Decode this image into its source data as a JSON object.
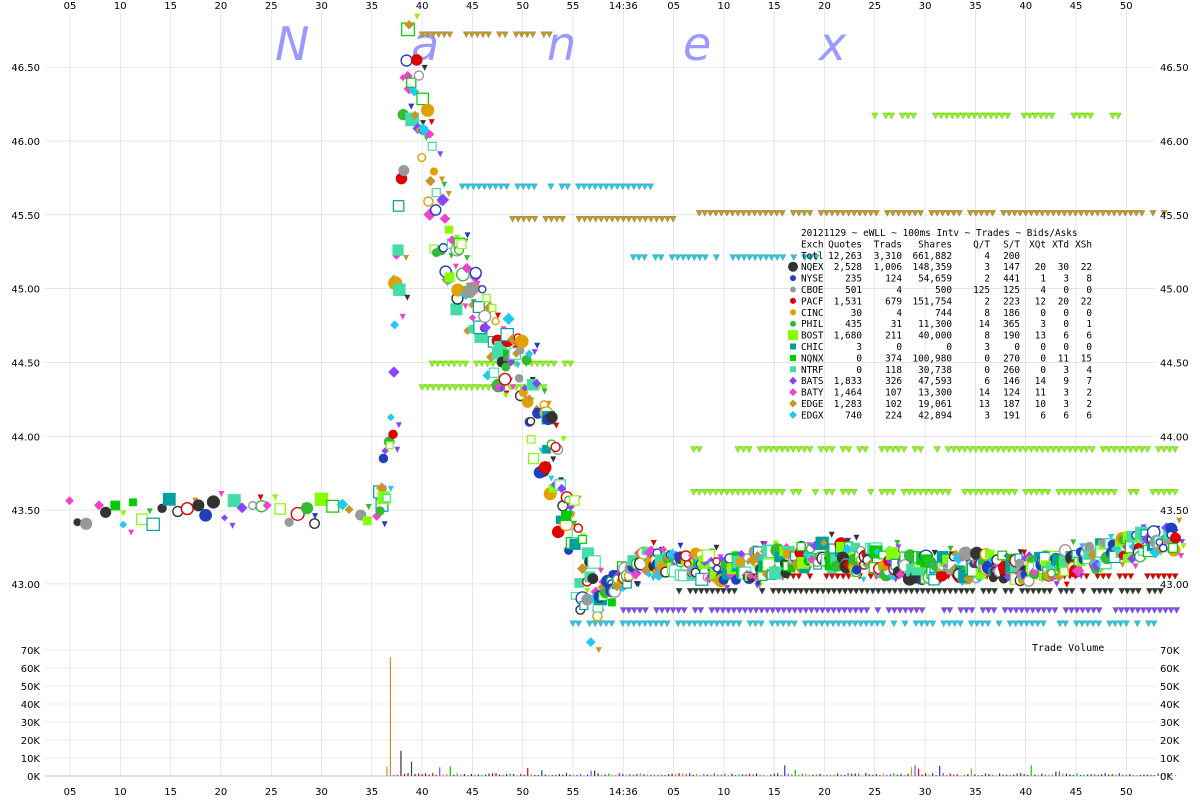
{
  "watermark": [
    "N",
    "a",
    "n",
    "e",
    "x"
  ],
  "chart_data": {
    "type": "scatter",
    "title": "20121129 ~ eWLL ~ 100ms Intv ~ Trades ~ Bids/Asks",
    "x_ticks": [
      "05",
      "10",
      "15",
      "20",
      "25",
      "30",
      "35",
      "40",
      "45",
      "50",
      "55",
      "14:36",
      "05",
      "10",
      "15",
      "20",
      "25",
      "30",
      "35",
      "40",
      "45",
      "50"
    ],
    "price_axis": {
      "ticks": [
        "46.50",
        "46.00",
        "45.50",
        "45.00",
        "44.50",
        "44.00",
        "43.50",
        "43.00"
      ],
      "values": [
        46.5,
        46.0,
        45.5,
        45.0,
        44.5,
        44.0,
        43.5,
        43.0
      ],
      "ylim": [
        42.62,
        46.82
      ]
    },
    "volume_axis": {
      "label": "Trade Volume",
      "ticks": [
        "70K",
        "60K",
        "50K",
        "40K",
        "30K",
        "20K",
        "10K",
        "0K"
      ],
      "values": [
        70000,
        60000,
        50000,
        40000,
        30000,
        20000,
        10000,
        0
      ],
      "ylim": [
        0,
        70000
      ]
    },
    "price_path": [
      [
        0,
        43.49
      ],
      [
        10,
        43.49
      ],
      [
        20,
        43.49
      ],
      [
        25,
        43.49
      ],
      [
        29,
        43.5
      ],
      [
        30.5,
        43.52
      ],
      [
        31.5,
        43.7
      ],
      [
        32,
        44.3
      ],
      [
        32.6,
        45.2
      ],
      [
        33.2,
        46.1
      ],
      [
        33.8,
        46.6
      ],
      [
        34.5,
        46.3
      ],
      [
        35.5,
        45.9
      ],
      [
        36.5,
        45.5
      ],
      [
        37.5,
        45.3
      ],
      [
        38.5,
        45.1
      ],
      [
        39.5,
        44.9
      ],
      [
        40.5,
        44.8
      ],
      [
        41.5,
        44.7
      ],
      [
        42.5,
        44.6
      ],
      [
        43.5,
        44.5
      ],
      [
        44.5,
        44.4
      ],
      [
        45.5,
        44.3
      ],
      [
        46.5,
        44.1
      ],
      [
        47.5,
        43.9
      ],
      [
        48.5,
        43.7
      ],
      [
        49.5,
        43.4
      ],
      [
        50.5,
        43.1
      ],
      [
        51.5,
        42.9
      ],
      [
        52.5,
        42.85
      ],
      [
        53.5,
        42.95
      ],
      [
        55,
        43.05
      ],
      [
        57,
        43.15
      ],
      [
        60,
        43.15
      ],
      [
        65,
        43.1
      ],
      [
        70,
        43.15
      ],
      [
        75,
        43.2
      ],
      [
        80,
        43.15
      ],
      [
        85,
        43.1
      ],
      [
        90,
        43.12
      ],
      [
        95,
        43.1
      ],
      [
        100,
        43.15
      ],
      [
        103,
        43.2
      ],
      [
        106,
        43.25
      ],
      [
        108,
        43.3
      ],
      [
        110,
        43.3
      ]
    ],
    "series": [
      {
        "name": "NQEX",
        "color": "#333333",
        "shape": "circle"
      },
      {
        "name": "NYSE",
        "color": "#1f3fbf",
        "shape": "circle"
      },
      {
        "name": "CBOE",
        "color": "#999999",
        "shape": "circle"
      },
      {
        "name": "PACF",
        "color": "#e00000",
        "shape": "circle"
      },
      {
        "name": "CINC",
        "color": "#e0a000",
        "shape": "circle"
      },
      {
        "name": "PHIL",
        "color": "#33bb33",
        "shape": "circle"
      },
      {
        "name": "BOST",
        "color": "#88ff00",
        "shape": "square"
      },
      {
        "name": "CHIC",
        "color": "#00a0a0",
        "shape": "square"
      },
      {
        "name": "NQNX",
        "color": "#00cc00",
        "shape": "square"
      },
      {
        "name": "NTRF",
        "color": "#44ddaa",
        "shape": "square"
      },
      {
        "name": "BATS",
        "color": "#8844ff",
        "shape": "diamond"
      },
      {
        "name": "BATY",
        "color": "#ee44cc",
        "shape": "diamond"
      },
      {
        "name": "EDGE",
        "color": "#c89628",
        "shape": "diamond"
      },
      {
        "name": "EDGX",
        "color": "#22c8ee",
        "shape": "diamond"
      }
    ],
    "table": {
      "header": [
        "Exch",
        "Quotes",
        "Trads",
        "Shares",
        "Q/T",
        "S/T",
        "XQt",
        "XTd",
        "XSh"
      ],
      "rows": [
        [
          "Totl",
          "12,263",
          "3,310",
          "661,882",
          "4",
          "200",
          "",
          "",
          ""
        ],
        [
          "NQEX",
          "2,528",
          "1,006",
          "148,359",
          "3",
          "147",
          "20",
          "30",
          "22"
        ],
        [
          "NYSE",
          "235",
          "124",
          "54,659",
          "2",
          "441",
          "1",
          "3",
          "8"
        ],
        [
          "CBOE",
          "501",
          "4",
          "500",
          "125",
          "125",
          "4",
          "0",
          "0"
        ],
        [
          "PACF",
          "1,531",
          "679",
          "151,754",
          "2",
          "223",
          "12",
          "20",
          "22"
        ],
        [
          "CINC",
          "30",
          "4",
          "744",
          "8",
          "186",
          "0",
          "0",
          "0"
        ],
        [
          "PHIL",
          "435",
          "31",
          "11,300",
          "14",
          "365",
          "3",
          "0",
          "1"
        ],
        [
          "BOST",
          "1,680",
          "211",
          "40,000",
          "8",
          "190",
          "13",
          "6",
          "6"
        ],
        [
          "CHIC",
          "3",
          "0",
          "0",
          "3",
          "0",
          "0",
          "0",
          "0"
        ],
        [
          "NQNX",
          "0",
          "374",
          "100,980",
          "0",
          "270",
          "0",
          "11",
          "15"
        ],
        [
          "NTRF",
          "0",
          "118",
          "30,738",
          "0",
          "260",
          "0",
          "3",
          "4"
        ],
        [
          "BATS",
          "1,833",
          "326",
          "47,593",
          "6",
          "146",
          "14",
          "9",
          "7"
        ],
        [
          "BATY",
          "1,464",
          "107",
          "13,300",
          "14",
          "124",
          "11",
          "3",
          "2"
        ],
        [
          "EDGE",
          "1,283",
          "102",
          "19,061",
          "13",
          "187",
          "10",
          "3",
          "2"
        ],
        [
          "EDGX",
          "740",
          "224",
          "42,894",
          "3",
          "191",
          "6",
          "6",
          "6"
        ]
      ]
    },
    "grid": true
  },
  "colors": {
    "grid": "#d8d8d8",
    "bid_colors": [
      "#88ff00",
      "#c89628",
      "#22c8ee",
      "#8844ff",
      "#ee44cc",
      "#33bb33",
      "#333333",
      "#e00000",
      "#1f3fbf"
    ]
  }
}
